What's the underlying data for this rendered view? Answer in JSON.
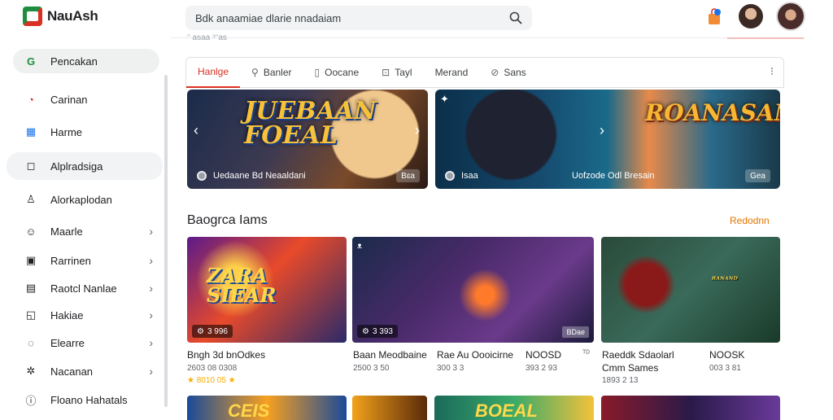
{
  "header": {
    "app_name": "NauAsh",
    "search_text": "Bdk anaamiae dlarie nnadaiam",
    "sub_crumb": "ᵔ asaa ᵓᵔas"
  },
  "sidebar": {
    "items": [
      {
        "label": "Pencakan",
        "icon": "G",
        "has_chevron": false
      },
      {
        "label": "Carinan",
        "icon": "◔",
        "has_chevron": false
      },
      {
        "label": "Harme",
        "icon": "▦",
        "has_chevron": false
      },
      {
        "label": "Alplradsiga",
        "icon": "◻",
        "has_chevron": false
      },
      {
        "label": "Alorkaplodan",
        "icon": "♙",
        "has_chevron": false
      },
      {
        "label": "Maarle",
        "icon": "☺",
        "has_chevron": true
      },
      {
        "label": "Rarrinen",
        "icon": "▣",
        "has_chevron": true
      },
      {
        "label": "Raotcl Nanlae",
        "icon": "▤",
        "has_chevron": true
      },
      {
        "label": "Hakiae",
        "icon": "◱",
        "has_chevron": true
      },
      {
        "label": "Elearre",
        "icon": "◌",
        "has_chevron": true
      },
      {
        "label": "Nacanan",
        "icon": "✲",
        "has_chevron": true
      },
      {
        "label": "Floano Hahatals",
        "icon": "ⓘ",
        "has_chevron": false
      }
    ]
  },
  "tabs": [
    {
      "label": "Hanlge",
      "icon": ""
    },
    {
      "label": "Banler",
      "icon": "⚲"
    },
    {
      "label": "Oocane",
      "icon": "▯"
    },
    {
      "label": "Tayl",
      "icon": "⊡"
    },
    {
      "label": "Merand",
      "icon": ""
    },
    {
      "label": "Sans",
      "icon": "⊘"
    }
  ],
  "tabs_more": "⁝",
  "banners": [
    {
      "title_line1": "JUEBAAN",
      "title_line2": "FOEAL",
      "caption": "Uedaane Bd Neaaldani",
      "badge": "Bɛa"
    },
    {
      "title": "ROANASAN",
      "caption_left": "Isaa",
      "caption_mid": "Uofzode Odl Bresain",
      "badge": "Gea"
    }
  ],
  "section": {
    "title": "Baogrca Iams",
    "link": "Redodnn"
  },
  "cards": [
    {
      "art": "ZARA",
      "art2": "SIEAR",
      "tag": "3 996",
      "title": "Bngh 3d bnOdkes",
      "sub": "2603 08 0308",
      "rating": "★ 8010 05 ★"
    },
    {
      "top": "ᴥ",
      "tag": "3 393",
      "badge": "BDae",
      "title_a": "Baan Meodbaine",
      "sub_a": "2500 3 50",
      "title_b": "Rae Au Oooicirne",
      "sub_b": "300 3 3",
      "title_c": "NOOSD",
      "sub_c": "393 2 93",
      "extra": "ᵀᴰ"
    },
    {
      "art": "ᴿᴬᴺᴬᴺᴰ",
      "title_a": "Raeddk Sdaolarl",
      "sub_a": "Cmm Sames",
      "sub_a2": "1893 2 13",
      "title_b": "NOOSK",
      "sub_b": "003 3 81"
    }
  ],
  "row2": [
    {
      "art": "CEIS"
    },
    {
      "art": ""
    },
    {
      "art": "BOEAL"
    },
    {
      "art": ""
    }
  ]
}
